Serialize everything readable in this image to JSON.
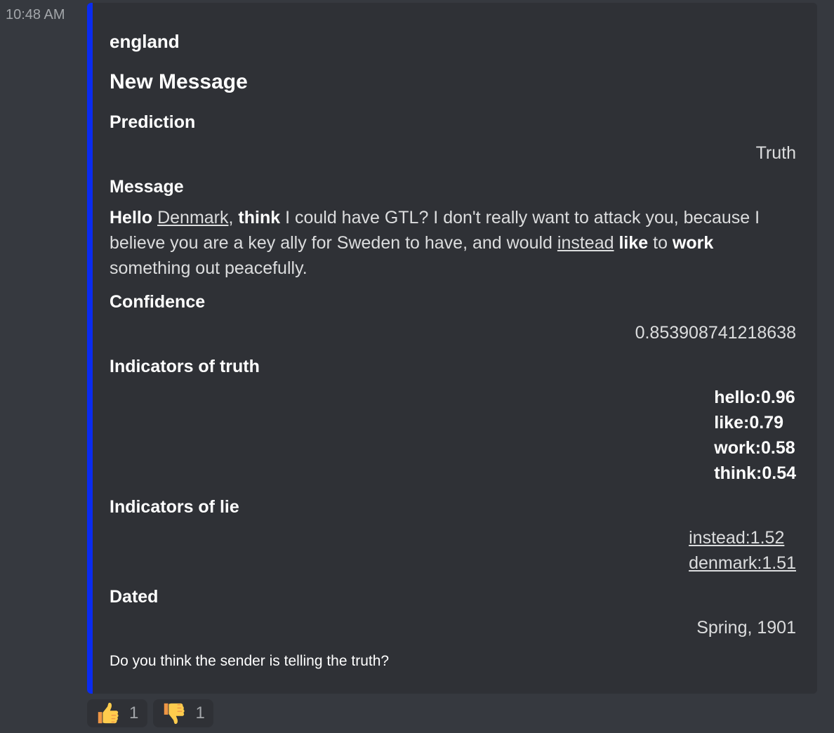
{
  "timestamp": "10:48 AM",
  "embed": {
    "accent_color": "#0a2bf0",
    "author": "england",
    "title": "New Message",
    "fields": {
      "prediction": {
        "name": "Prediction",
        "value": "Truth"
      },
      "message": {
        "name": "Message",
        "segments": [
          {
            "text": "Hello",
            "style": "bold"
          },
          {
            "text": " ",
            "style": "plain"
          },
          {
            "text": "Denmark",
            "style": "underline"
          },
          {
            "text": ", ",
            "style": "plain"
          },
          {
            "text": "think",
            "style": "bold"
          },
          {
            "text": " I could have GTL? I don't really want to attack you, because I believe you are a key ally for Sweden to have, and would ",
            "style": "plain"
          },
          {
            "text": "instead",
            "style": "underline"
          },
          {
            "text": " ",
            "style": "plain"
          },
          {
            "text": "like",
            "style": "bold"
          },
          {
            "text": " to ",
            "style": "plain"
          },
          {
            "text": "work",
            "style": "bold"
          },
          {
            "text": " something out peacefully.",
            "style": "plain"
          }
        ]
      },
      "confidence": {
        "name": "Confidence",
        "value": "0.853908741218638"
      },
      "indicators_truth": {
        "name": "Indicators of truth",
        "items": [
          "hello:0.96",
          "like:0.79",
          "work:0.58",
          "think:0.54"
        ]
      },
      "indicators_lie": {
        "name": "Indicators of lie",
        "items": [
          "instead:1.52",
          "denmark:1.51"
        ]
      },
      "dated": {
        "name": "Dated",
        "value": "Spring, 1901"
      }
    },
    "footer": "Do you think the sender is telling the truth?"
  },
  "reactions": [
    {
      "emoji": "thumbs-up-icon",
      "count": "1"
    },
    {
      "emoji": "thumbs-down-icon",
      "count": "1"
    }
  ]
}
